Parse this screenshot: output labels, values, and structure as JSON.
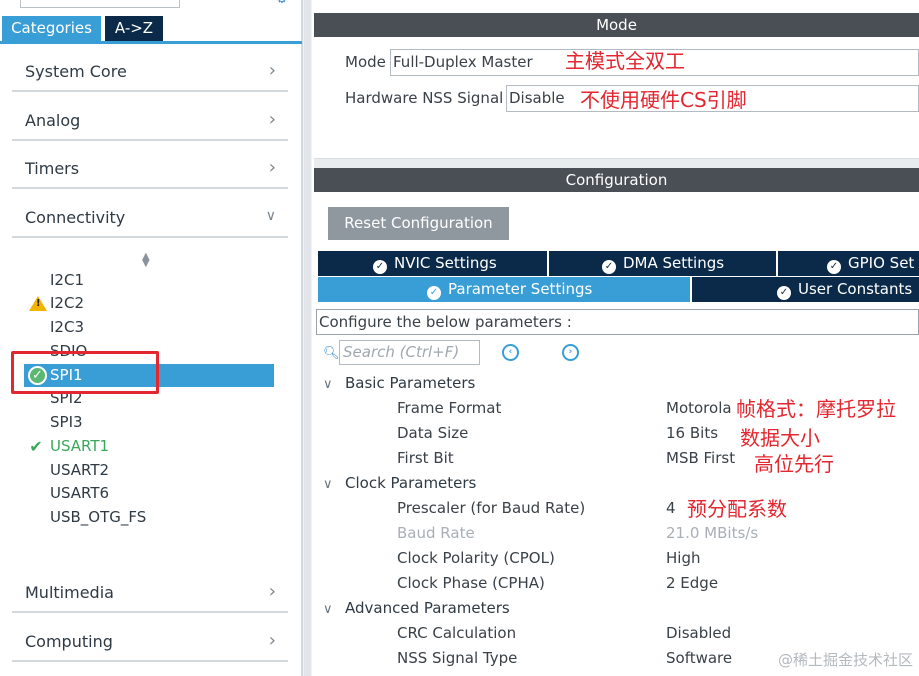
{
  "left_panel": {
    "tabs": {
      "categories": "Categories",
      "atoz": "A->Z"
    },
    "categories": [
      {
        "label": "System Core",
        "expanded": false
      },
      {
        "label": "Analog",
        "expanded": false
      },
      {
        "label": "Timers",
        "expanded": false
      },
      {
        "label": "Connectivity",
        "expanded": true
      },
      {
        "label": "Multimedia",
        "expanded": false
      },
      {
        "label": "Computing",
        "expanded": false
      }
    ],
    "peripherals": [
      {
        "name": "I2C1",
        "status": "none"
      },
      {
        "name": "I2C2",
        "status": "warning"
      },
      {
        "name": "I2C3",
        "status": "none"
      },
      {
        "name": "SDIO",
        "status": "none"
      },
      {
        "name": "SPI1",
        "status": "selected-ok"
      },
      {
        "name": "SPI2",
        "status": "none"
      },
      {
        "name": "SPI3",
        "status": "none"
      },
      {
        "name": "USART1",
        "status": "enabled"
      },
      {
        "name": "USART2",
        "status": "none"
      },
      {
        "name": "USART6",
        "status": "none"
      },
      {
        "name": "USB_OTG_FS",
        "status": "none"
      }
    ]
  },
  "right_panel": {
    "mode_header": "Mode",
    "mode_label": "Mode",
    "mode_value": "Full-Duplex Master",
    "mode_annotation": "主模式全双工",
    "nss_label": "Hardware NSS Signal",
    "nss_value": "Disable",
    "nss_annotation": "不使用硬件CS引脚",
    "config_header": "Configuration",
    "reset_button": "Reset Configuration",
    "tabs_row1": [
      "NVIC Settings",
      "DMA Settings",
      "GPIO Set"
    ],
    "tabs_row2": [
      "Parameter Settings",
      "User Constants"
    ],
    "configure_text": "Configure the below parameters :",
    "search_placeholder": "Search (Ctrl+F)",
    "sections": [
      {
        "title": "Basic Parameters",
        "params": [
          {
            "label": "Frame Format",
            "value": "Motorola",
            "annotation": "帧格式：摩托罗拉"
          },
          {
            "label": "Data Size",
            "value": "16 Bits",
            "annotation": "数据大小"
          },
          {
            "label": "First Bit",
            "value": "MSB First",
            "annotation": "高位先行"
          }
        ]
      },
      {
        "title": "Clock Parameters",
        "params": [
          {
            "label": "Prescaler (for Baud Rate)",
            "value": "4",
            "annotation": "预分配系数"
          },
          {
            "label": "Baud Rate",
            "value": "21.0 MBits/s",
            "disabled": true
          },
          {
            "label": "Clock Polarity (CPOL)",
            "value": "High"
          },
          {
            "label": "Clock Phase (CPHA)",
            "value": "2 Edge"
          }
        ]
      },
      {
        "title": "Advanced Parameters",
        "params": [
          {
            "label": "CRC Calculation",
            "value": "Disabled"
          },
          {
            "label": "NSS Signal Type",
            "value": "Software"
          }
        ]
      }
    ],
    "watermark": "@稀土掘金技术社区"
  },
  "colors": {
    "accent_blue": "#3a9ed6",
    "dark_navy": "#0b2a4a",
    "header_gray": "#4a4f55",
    "annotation_red": "#e3262f",
    "ok_green": "#3aa85a"
  }
}
